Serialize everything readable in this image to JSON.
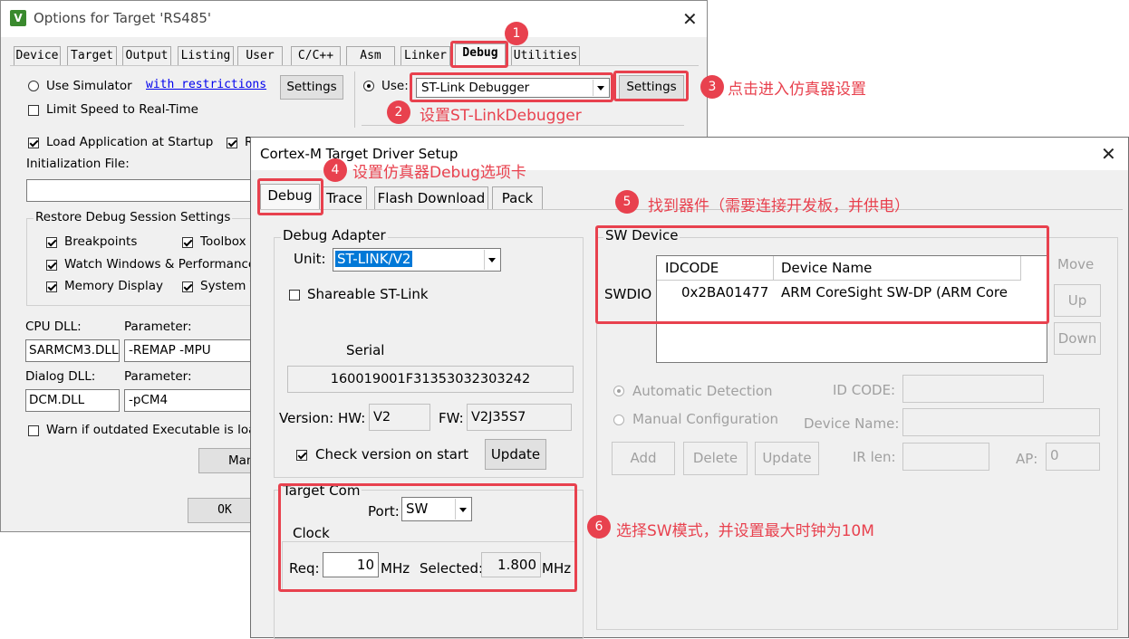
{
  "options": {
    "title": "Options for Target 'RS485'",
    "close": "✕",
    "tabs": [
      "Device",
      "Target",
      "Output",
      "Listing",
      "User",
      "C/C++",
      "Asm",
      "Linker",
      "Debug",
      "Utilities"
    ],
    "use_simulator": "Use Simulator",
    "with_restrictions": "with restrictions",
    "settings": "Settings",
    "limit_speed": "Limit Speed to Real-Time",
    "use": "Use:",
    "debugger_value": "ST-Link Debugger",
    "load_app": "Load Application at Startup",
    "run_to_main_partial": "R",
    "init_file": "Initialization File:",
    "restore_group": "Restore Debug Session Settings",
    "breakpoints": "Breakpoints",
    "toolbox": "Toolbox",
    "watch_windows": "Watch Windows & Performance An",
    "memory_display": "Memory Display",
    "system_viewer": "System V",
    "cpu_dll_label": "CPU DLL:",
    "cpu_param_label": "Parameter:",
    "cpu_dll": "SARMCM3.DLL",
    "cpu_param": "-REMAP -MPU",
    "dialog_dll_label": "Dialog DLL:",
    "dialog_param_label": "Parameter:",
    "dialog_dll": "DCM.DLL",
    "dialog_param": "-pCM4",
    "warn_outdated": "Warn if outdated Executable is loaded",
    "manage_partial": "Man",
    "ok": "OK"
  },
  "driver": {
    "title": "Cortex-M Target Driver Setup",
    "close": "✕",
    "tabs": [
      "Debug",
      "Trace",
      "Flash Download",
      "Pack"
    ],
    "debug_adapter": "Debug Adapter",
    "unit_label": "Unit:",
    "unit_value": "ST-LINK/V2",
    "shareable": "Shareable ST-Link",
    "serial_label": "Serial",
    "serial": "160019001F31353032303242",
    "version_hw_label": "Version: HW:",
    "hw": "V2",
    "fw_label": "FW:",
    "fw": "V2J35S7",
    "check_version": "Check version on start",
    "update": "Update",
    "target_com": "Target Com",
    "port_label": "Port:",
    "port_value": "SW",
    "clock": "Clock",
    "req_label": "Req:",
    "req_value": "10",
    "mhz1": "MHz",
    "selected_label": "Selected:",
    "selected_value": "1.800",
    "mhz2": "MHz",
    "sw_device": "SW Device",
    "col_idcode": "IDCODE",
    "col_device": "Device Name",
    "swdio": "SWDIO",
    "row_idcode": "0x2BA01477",
    "row_device": "ARM CoreSight SW-DP (ARM Core",
    "move": "Move",
    "up": "Up",
    "down": "Down",
    "auto_detect": "Automatic Detection",
    "manual_config": "Manual Configuration",
    "id_code_label": "ID CODE:",
    "device_name_label": "Device Name:",
    "add": "Add",
    "delete": "Delete",
    "update2": "Update",
    "ir_len_label": "IR len:",
    "ap_label": "AP:",
    "ap_value": "0"
  },
  "annotations": {
    "b1": "1",
    "b2": "2",
    "b3": "3",
    "b4": "4",
    "b5": "5",
    "b6": "6",
    "n2": "设置ST-LinkDebugger",
    "n3": "点击进入仿真器设置",
    "n4": "设置仿真器Debug选项卡",
    "n5": "找到器件（需要连接开发板，并供电）",
    "n6": "选择SW模式，并设置最大时钟为10M"
  },
  "colors": {
    "accent": "#e8414e",
    "selection": "#0078d7"
  }
}
